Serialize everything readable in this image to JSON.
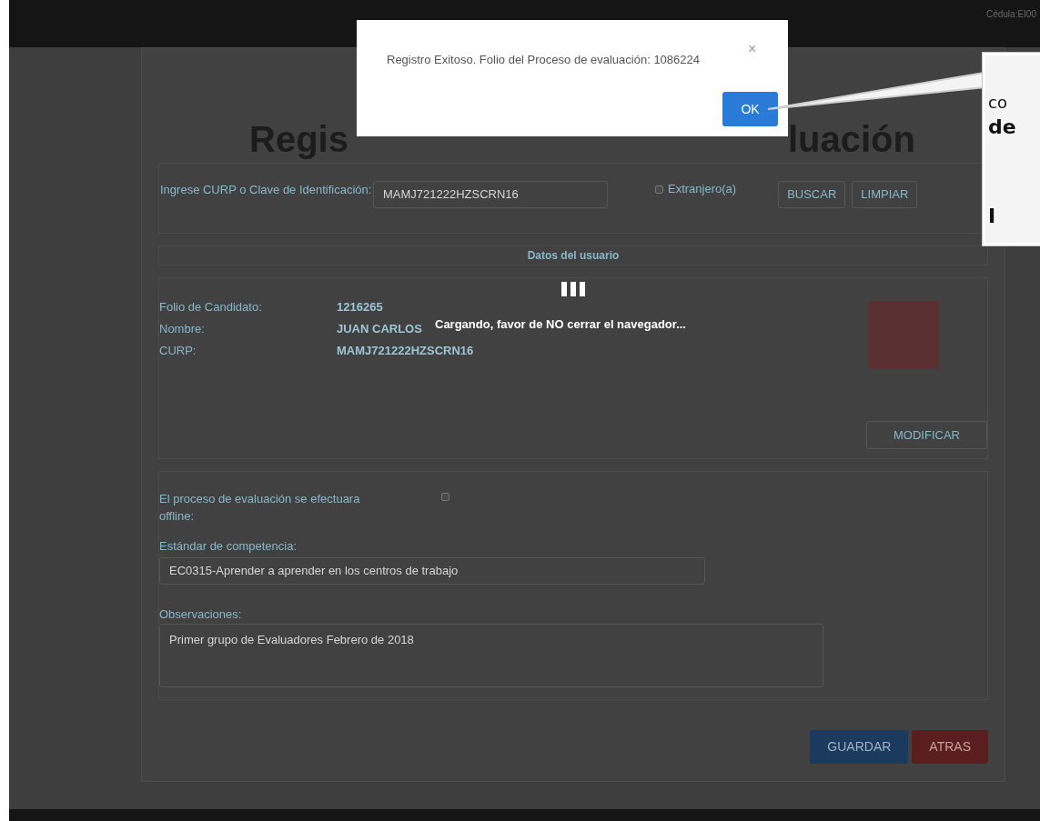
{
  "top_bar": {
    "user_label": "Cédula:EI00"
  },
  "title_parts": [
    "Regis",
    "luación"
  ],
  "search": {
    "label": "Ingrese CURP o Clave de Identificación:",
    "value": "MAMJ721222HZSCRN16",
    "foreign": {
      "label": "Extranjero(a)",
      "checked": false
    },
    "buttons": [
      "BUSCAR",
      "LIMPIAR"
    ]
  },
  "user_section": {
    "heading": "Datos del usuario",
    "fields": [
      {
        "label": "Folio de Candidato:",
        "value": "1216265"
      },
      {
        "label": "Nombre:",
        "value": "JUAN CARLOS"
      },
      {
        "label": "CURP:",
        "value": "MAMJ721222HZSCRN16"
      }
    ],
    "button": "MODIFICAR"
  },
  "offline": {
    "label": "El proceso de evaluación se efectuara offline:",
    "checked": false
  },
  "standard": {
    "label": "Estándar de competencia:",
    "value": "EC0315-Aprender a aprender en los centros de trabajo"
  },
  "observations": {
    "label": "Observaciones:",
    "value": "Primer grupo de Evaluadores Febrero de 2018"
  },
  "actions": [
    {
      "label": "GUARDAR",
      "kind": "primary"
    },
    {
      "label": "ATRAS",
      "kind": "danger"
    }
  ],
  "loading": {
    "message": "Cargando, favor de NO cerrar el navegador..."
  },
  "dialog": {
    "message": "Registro Exitoso. Folio del Proceso de evaluación: 1086224",
    "button": "OK",
    "close": "×"
  },
  "callout": {
    "lines": [
      {
        "text": "co",
        "bold": false
      },
      {
        "text": "de",
        "bold": true
      },
      {
        "text": "I",
        "bold": true
      }
    ]
  }
}
